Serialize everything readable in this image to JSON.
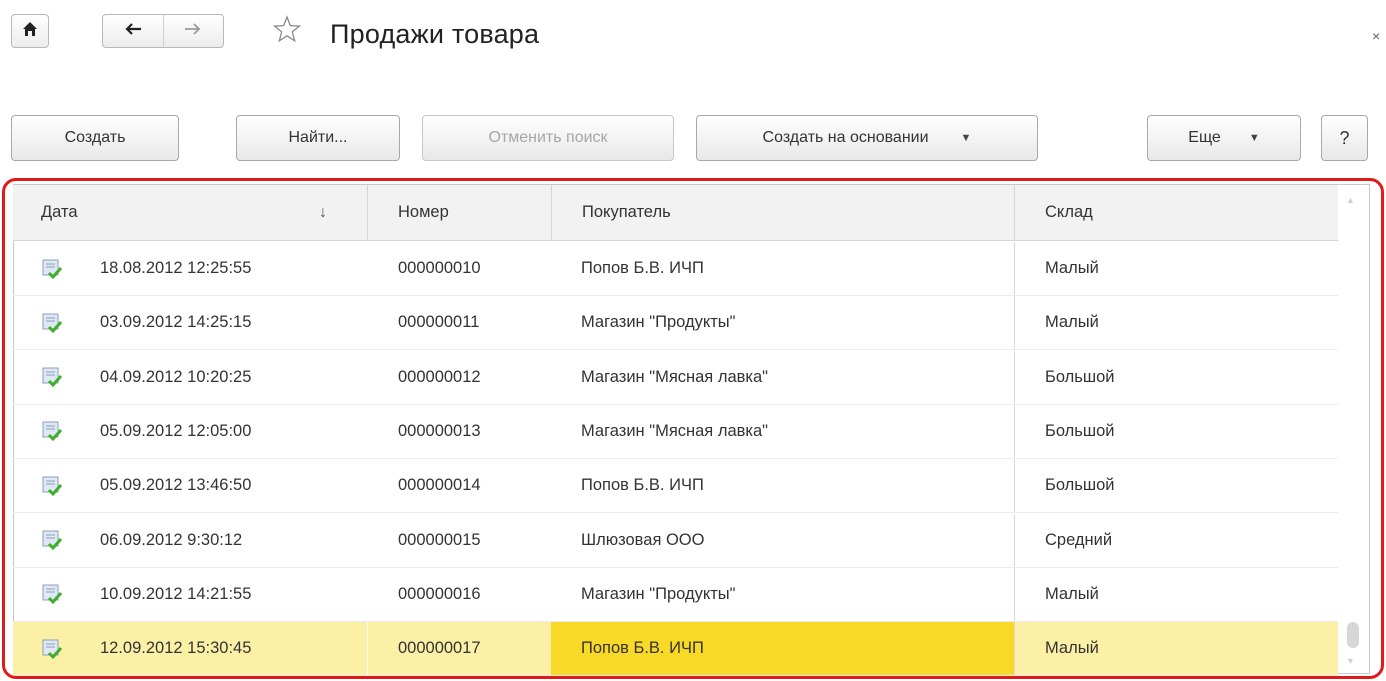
{
  "window": {
    "title": "Продажи товара",
    "close_glyph": "×"
  },
  "toolbar": {
    "create_label": "Создать",
    "find_label": "Найти...",
    "cancel_search_label": "Отменить поиск",
    "create_based_label": "Создать на основании",
    "more_label": "Еще",
    "help_label": "?"
  },
  "table": {
    "columns": {
      "date": "Дата",
      "number": "Номер",
      "buyer": "Покупатель",
      "warehouse": "Склад"
    },
    "sort_indicator": "↓",
    "rows": [
      {
        "date": "18.08.2012 12:25:55",
        "number": "000000010",
        "buyer": "Попов Б.В. ИЧП",
        "warehouse": "Малый"
      },
      {
        "date": "03.09.2012 14:25:15",
        "number": "000000011",
        "buyer": "Магазин \"Продукты\"",
        "warehouse": "Малый"
      },
      {
        "date": "04.09.2012 10:20:25",
        "number": "000000012",
        "buyer": "Магазин \"Мясная лавка\"",
        "warehouse": "Большой"
      },
      {
        "date": "05.09.2012 12:05:00",
        "number": "000000013",
        "buyer": "Магазин \"Мясная лавка\"",
        "warehouse": "Большой"
      },
      {
        "date": "05.09.2012 13:46:50",
        "number": "000000014",
        "buyer": "Попов Б.В. ИЧП",
        "warehouse": "Большой"
      },
      {
        "date": "06.09.2012 9:30:12",
        "number": "000000015",
        "buyer": "Шлюзовая ООО",
        "warehouse": "Средний"
      },
      {
        "date": "10.09.2012 14:21:55",
        "number": "000000016",
        "buyer": "Магазин \"Продукты\"",
        "warehouse": "Малый"
      },
      {
        "date": "12.09.2012 15:30:45",
        "number": "000000017",
        "buyer": "Попов Б.В. ИЧП",
        "warehouse": "Малый"
      }
    ]
  },
  "icons": {
    "home": "home-icon",
    "back": "arrow-left-icon",
    "forward": "arrow-right-icon",
    "favorite": "star-icon",
    "document": "posted-document-icon",
    "dropdown": "caret-down-icon"
  },
  "colors": {
    "selected_row": "#fbf0a5",
    "selected_cell": "#f9d927",
    "highlight_outline": "#e01a1a",
    "posted_check": "#3fae2a"
  }
}
